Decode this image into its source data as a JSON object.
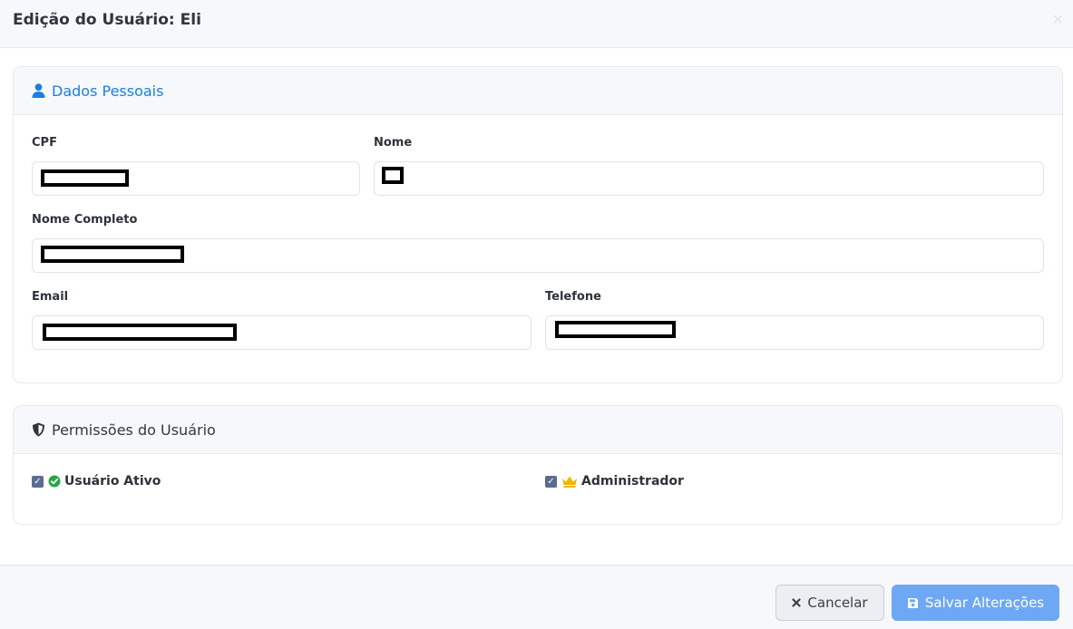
{
  "modal": {
    "title": "Edição do Usuário: Eli",
    "close_icon": "close-icon"
  },
  "personal": {
    "title": "Dados Pessoais",
    "icon": "user-icon",
    "accent_color": "#1a7fe0",
    "fields": {
      "cpf": {
        "label": "CPF",
        "value": ""
      },
      "nome": {
        "label": "Nome",
        "value": ""
      },
      "nome_completo": {
        "label": "Nome Completo",
        "value": ""
      },
      "email": {
        "label": "Email",
        "value": ""
      },
      "telefone": {
        "label": "Telefone",
        "value": ""
      }
    }
  },
  "permissions": {
    "title": "Permissões do Usuário",
    "icon": "shield-icon",
    "items": [
      {
        "label": "Usuário Ativo",
        "checked": true,
        "icon": "check-circle-icon",
        "icon_color": "#28a745"
      },
      {
        "label": "Administrador",
        "checked": true,
        "icon": "crown-icon",
        "icon_color": "#f4b400"
      }
    ]
  },
  "footer": {
    "cancel_label": "Cancelar",
    "cancel_icon": "x-icon",
    "save_label": "Salvar Alterações",
    "save_icon": "floppy-disk-icon",
    "save_color": "#6ea8f5"
  }
}
